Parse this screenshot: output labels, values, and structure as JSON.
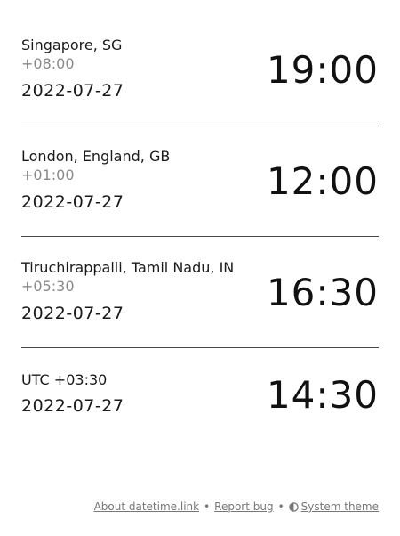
{
  "zones": [
    {
      "name": "Singapore, SG",
      "offset": "+08:00",
      "date": "2022-07-27",
      "time": "19:00"
    },
    {
      "name": "London, England, GB",
      "offset": "+01:00",
      "date": "2022-07-27",
      "time": "12:00"
    },
    {
      "name": "Tiruchirappalli, Tamil Nadu, IN",
      "offset": "+05:30",
      "date": "2022-07-27",
      "time": "16:30"
    },
    {
      "name": "UTC +03:30",
      "date": "2022-07-27",
      "time": "14:30"
    }
  ],
  "footer": {
    "about": "About datetime.link",
    "separator": "•",
    "report": "Report bug",
    "theme": "System theme",
    "theme_icon": "half-circle-contrast-icon"
  }
}
